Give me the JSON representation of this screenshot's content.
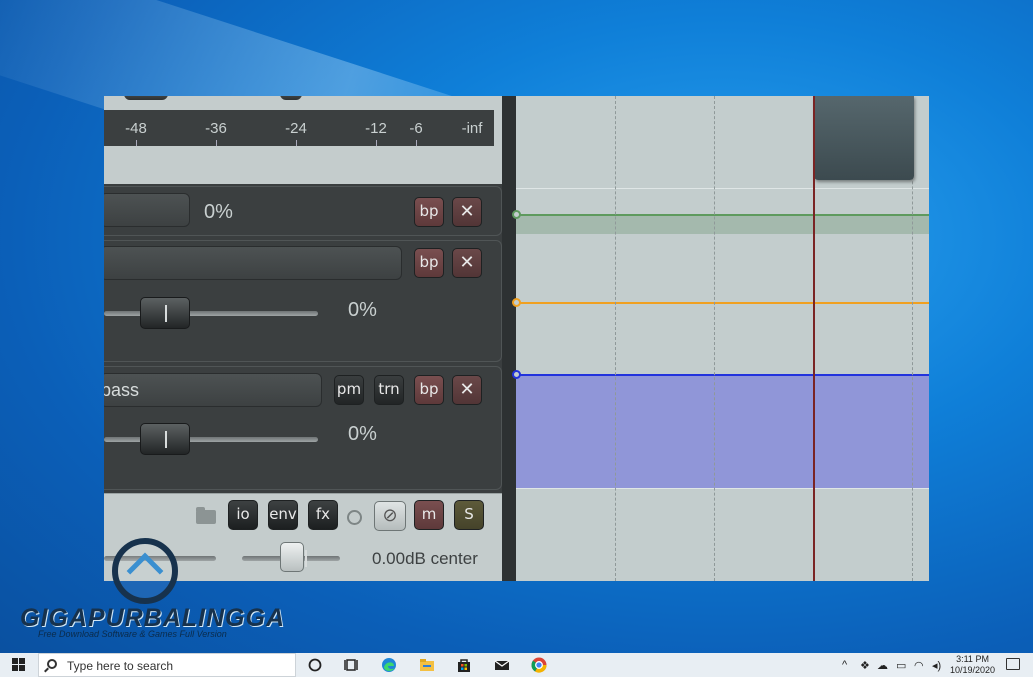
{
  "meter": {
    "scale_labels": [
      "-48",
      "-36",
      "-24",
      "-12",
      "-6",
      "-inf"
    ]
  },
  "rows": [
    {
      "percent": "0%",
      "buttons": [
        "bp",
        "✕"
      ]
    },
    {
      "name": "",
      "percent": "0%",
      "buttons": [
        "bp",
        "✕"
      ]
    },
    {
      "name": "pass",
      "percent": "0%",
      "buttons": [
        "pm",
        "trn",
        "bp",
        "✕"
      ]
    }
  ],
  "master": {
    "buttons": [
      "io",
      "env",
      "fx",
      "m",
      "S"
    ],
    "phase_icon": "⊘",
    "readout": "0.00dB  center"
  },
  "colors": {
    "env_green": "#5e9a5e",
    "env_orange": "#f0a020",
    "env_blue": "#2233dd",
    "play_cursor": "#7a2424"
  },
  "watermark": {
    "title": "GIGAPURBALINGGA",
    "subtitle": "Free Download Software & Games Full Version"
  },
  "taskbar": {
    "search_placeholder": "Type here to search",
    "time": "3:11 PM",
    "date": "10/19/2020",
    "icons": [
      "cortana-icon",
      "task-view-icon",
      "edge-icon",
      "file-explorer-icon",
      "store-icon",
      "mail-icon",
      "chrome-icon"
    ],
    "tray_icons": [
      "chevron-up-icon",
      "dropbox-icon",
      "onedrive-icon",
      "battery-icon",
      "wifi-icon",
      "volume-icon"
    ]
  }
}
